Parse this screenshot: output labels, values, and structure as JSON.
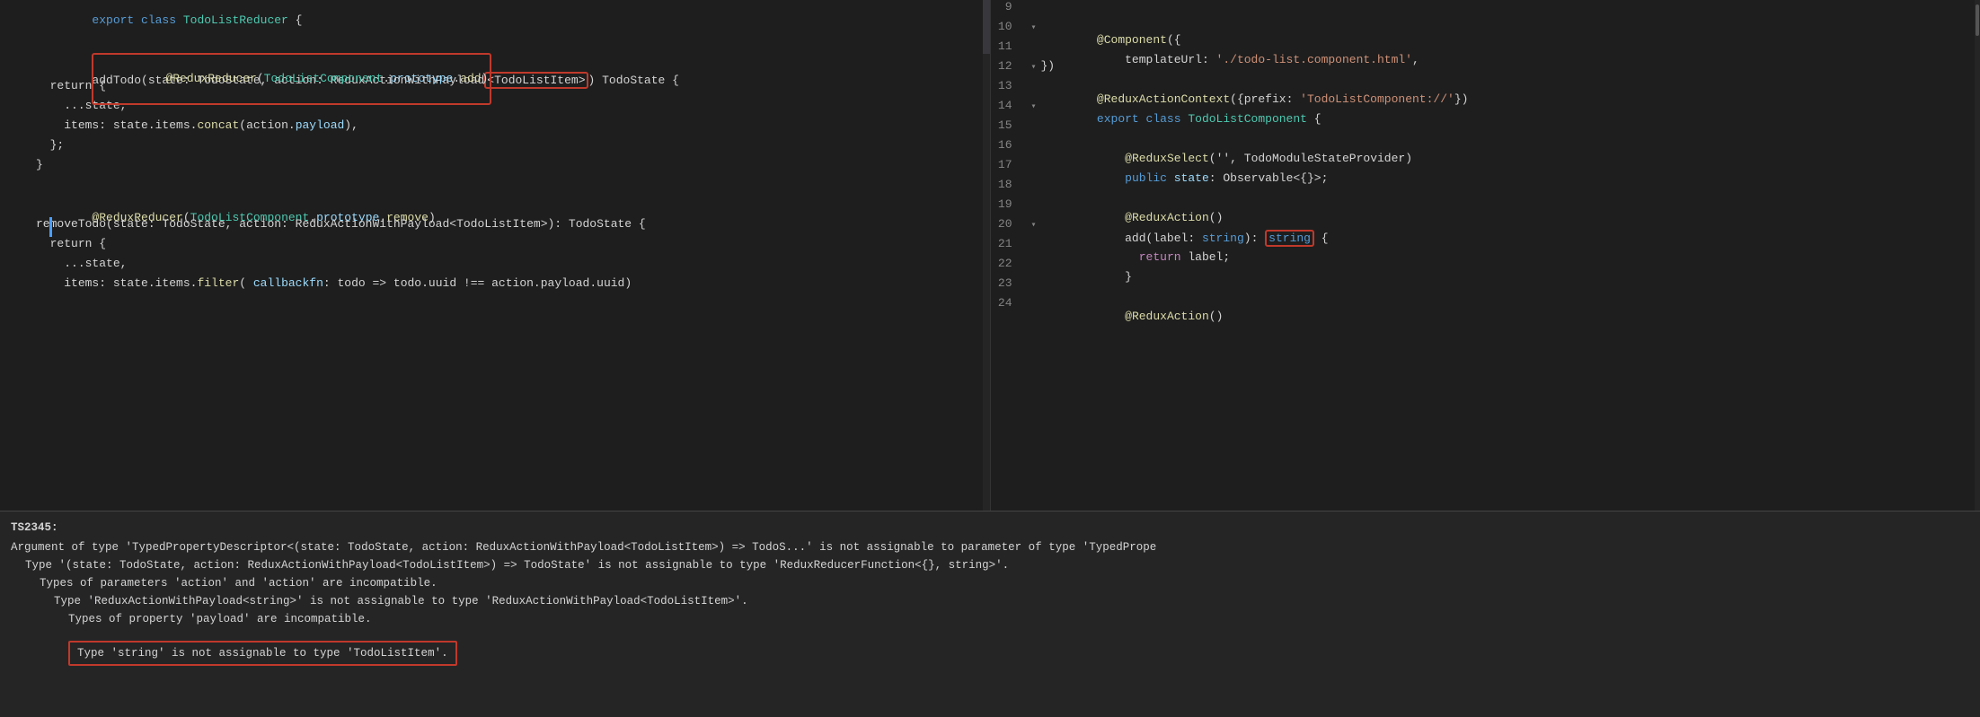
{
  "editor": {
    "left_panel": {
      "lines": [
        {
          "num": "",
          "tokens": [
            {
              "text": "export ",
              "cls": "kw"
            },
            {
              "text": "class ",
              "cls": "kw"
            },
            {
              "text": "TodoListReducer",
              "cls": "cls"
            },
            {
              "text": " {",
              "cls": "plain"
            }
          ]
        },
        {
          "num": "",
          "tokens": []
        },
        {
          "num": "",
          "highlight": true,
          "tokens": [
            {
              "text": "@ReduxReducer",
              "cls": "dec-name"
            },
            {
              "text": "(",
              "cls": "plain"
            },
            {
              "text": "TodoListComponent",
              "cls": "cls"
            },
            {
              "text": ".",
              "cls": "plain"
            },
            {
              "text": "prototype",
              "cls": "prop"
            },
            {
              "text": ".",
              "cls": "plain"
            },
            {
              "text": "add",
              "cls": "fn"
            },
            {
              "text": ")",
              "cls": "plain"
            }
          ]
        },
        {
          "num": "",
          "tokens": [
            {
              "text": "addTodo(state: TodoState, action: ReduxActionWithPayload",
              "cls": "plain"
            },
            {
              "text": "<TodoListItem>",
              "cls": "highlight2"
            },
            {
              "text": ") TodoState {",
              "cls": "plain"
            }
          ]
        },
        {
          "num": "",
          "tokens": [
            {
              "text": "  return {",
              "cls": "plain"
            }
          ],
          "indent": 1
        },
        {
          "num": "",
          "tokens": [
            {
              "text": "    ...state,",
              "cls": "plain"
            }
          ],
          "indent": 2
        },
        {
          "num": "",
          "tokens": [
            {
              "text": "    items: state.items.",
              "cls": "plain"
            },
            {
              "text": "concat",
              "cls": "fn"
            },
            {
              "text": "(action.",
              "cls": "plain"
            },
            {
              "text": "payload",
              "cls": "prop"
            },
            {
              "text": "),",
              "cls": "plain"
            }
          ],
          "indent": 2
        },
        {
          "num": "",
          "tokens": [
            {
              "text": "  };",
              "cls": "plain"
            }
          ],
          "indent": 1
        },
        {
          "num": "",
          "tokens": [
            {
              "text": "}",
              "cls": "plain"
            }
          ]
        },
        {
          "num": "",
          "tokens": []
        },
        {
          "num": "",
          "tokens": [
            {
              "text": "@ReduxReducer",
              "cls": "dec-name"
            },
            {
              "text": "(",
              "cls": "plain"
            },
            {
              "text": "TodoListComponent",
              "cls": "cls"
            },
            {
              "text": ".",
              "cls": "plain"
            },
            {
              "text": "prototype",
              "cls": "prop"
            },
            {
              "text": ".",
              "cls": "plain"
            },
            {
              "text": "remove",
              "cls": "fn"
            },
            {
              "text": ")",
              "cls": "plain"
            }
          ]
        },
        {
          "num": "",
          "tokens": [
            {
              "text": "removeTodo(state: TodoState, action: ReduxActionWithPayload<TodoListItem>): TodoState {",
              "cls": "plain"
            }
          ]
        },
        {
          "num": "",
          "tokens": [
            {
              "text": "  return {",
              "cls": "plain"
            }
          ]
        },
        {
          "num": "",
          "tokens": [
            {
              "text": "    ...state,",
              "cls": "plain"
            }
          ]
        },
        {
          "num": "",
          "tokens": [
            {
              "text": "    items: state.items.",
              "cls": "plain"
            },
            {
              "text": "filter",
              "cls": "fn"
            },
            {
              "text": "( ",
              "cls": "plain"
            },
            {
              "text": "callbackfn",
              "cls": "param-color"
            },
            {
              "text": ": todo => todo.uuid !== action.payload.uuid)",
              "cls": "plain"
            }
          ]
        }
      ]
    },
    "right_panel": {
      "lines": [
        {
          "num": "9",
          "tokens": []
        },
        {
          "num": "10",
          "tokens": [
            {
              "text": "  ",
              "cls": "plain"
            },
            {
              "text": "@Component",
              "cls": "dec-name"
            },
            {
              "text": "({",
              "cls": "plain"
            }
          ]
        },
        {
          "num": "11",
          "tokens": [
            {
              "text": "    templateUrl: ",
              "cls": "plain"
            },
            {
              "text": "'./todo-list.component.html'",
              "cls": "str"
            },
            {
              "text": ",",
              "cls": "plain"
            }
          ]
        },
        {
          "num": "12",
          "tokens": [
            {
              "text": "  })",
              "cls": "plain"
            }
          ]
        },
        {
          "num": "13",
          "tokens": [
            {
              "text": "  ",
              "cls": "plain"
            },
            {
              "text": "@ReduxActionContext",
              "cls": "dec-name"
            },
            {
              "text": "({prefix: ",
              "cls": "plain"
            },
            {
              "text": "'TodoListComponent://'",
              "cls": "str"
            },
            {
              "text": "})",
              "cls": "plain"
            }
          ]
        },
        {
          "num": "14",
          "tokens": [
            {
              "text": "  ",
              "cls": "plain"
            },
            {
              "text": "export ",
              "cls": "kw"
            },
            {
              "text": "class ",
              "cls": "kw"
            },
            {
              "text": "TodoListComponent",
              "cls": "cls"
            },
            {
              "text": " {",
              "cls": "plain"
            }
          ]
        },
        {
          "num": "15",
          "tokens": []
        },
        {
          "num": "16",
          "tokens": [
            {
              "text": "    ",
              "cls": "plain"
            },
            {
              "text": "@ReduxSelect",
              "cls": "dec-name"
            },
            {
              "text": "('', TodoModuleStateProvider)",
              "cls": "plain"
            }
          ]
        },
        {
          "num": "17",
          "tokens": [
            {
              "text": "    ",
              "cls": "plain"
            },
            {
              "text": "public ",
              "cls": "kw"
            },
            {
              "text": "state",
              "cls": "prop"
            },
            {
              "text": ": Observable<{}>",
              "cls": "plain"
            },
            {
              "text": ";",
              "cls": "plain"
            }
          ]
        },
        {
          "num": "18",
          "tokens": []
        },
        {
          "num": "19",
          "tokens": [
            {
              "text": "    ",
              "cls": "plain"
            },
            {
              "text": "@ReduxAction",
              "cls": "dec-name"
            },
            {
              "text": "()",
              "cls": "plain"
            }
          ]
        },
        {
          "num": "20",
          "tokens": [
            {
              "text": "    add(label: ",
              "cls": "plain"
            },
            {
              "text": "string",
              "cls": "kw"
            },
            {
              "text": "): ",
              "cls": "plain"
            },
            {
              "text": "string",
              "cls": "highlight3"
            },
            {
              "text": " {",
              "cls": "plain"
            }
          ]
        },
        {
          "num": "21",
          "tokens": [
            {
              "text": "      ",
              "cls": "plain"
            },
            {
              "text": "return ",
              "cls": "kw-ctrl"
            },
            {
              "text": "label;",
              "cls": "plain"
            }
          ]
        },
        {
          "num": "22",
          "tokens": [
            {
              "text": "    }",
              "cls": "plain"
            }
          ]
        },
        {
          "num": "23",
          "tokens": []
        },
        {
          "num": "24",
          "tokens": [
            {
              "text": "    ",
              "cls": "plain"
            },
            {
              "text": "@ReduxAction",
              "cls": "dec-name"
            },
            {
              "text": "()",
              "cls": "plain"
            }
          ]
        }
      ]
    }
  },
  "error_panel": {
    "code": "TS2345:",
    "lines": [
      "Argument of type 'TypedPropertyDescriptor<(state: TodoState, action: ReduxActionWithPayload<TodoListItem>) => TodoS...' is not assignable to parameter of type 'TypedPrope",
      "  Type '(state: TodoState, action: ReduxActionWithPayload<TodoListItem>) => TodoState' is not assignable to type 'ReduxReducerFunction<{}, string>'.",
      "    Types of parameters 'action' and 'action' are incompatible.",
      "      Type 'ReduxActionWithPayload<string>' is not assignable to type 'ReduxActionWithPayload<TodoListItem>'.",
      "        Types of property 'payload' are incompatible."
    ],
    "highlighted_line": "Type 'string' is not assignable to type 'TodoListItem'."
  }
}
